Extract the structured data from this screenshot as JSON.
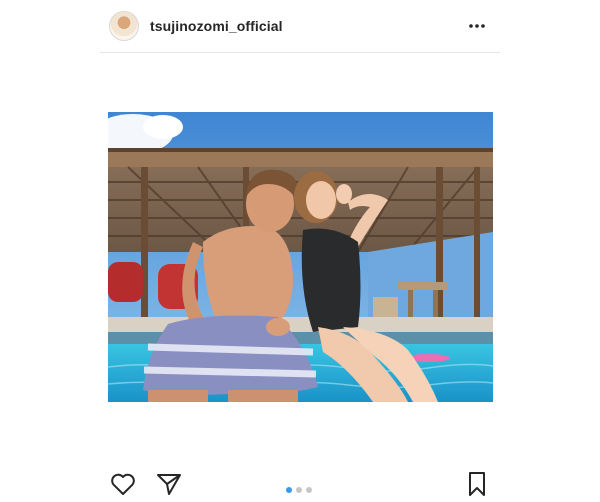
{
  "post": {
    "username": "tsujinozomi_official",
    "avatar_alt": "profile",
    "photo": {
      "scene": "couple sitting at pool edge under wooden pavilion"
    },
    "carousel": {
      "total": 3,
      "active": 1
    },
    "icons": {
      "more": "more-options-icon",
      "like": "heart-icon",
      "share": "paper-plane-icon",
      "save": "bookmark-icon"
    }
  },
  "colors": {
    "text": "#262626",
    "accent": "#3897f0",
    "divider": "#e6e6e6",
    "sky": "#4f93d8",
    "pool": "#27b6d8"
  }
}
